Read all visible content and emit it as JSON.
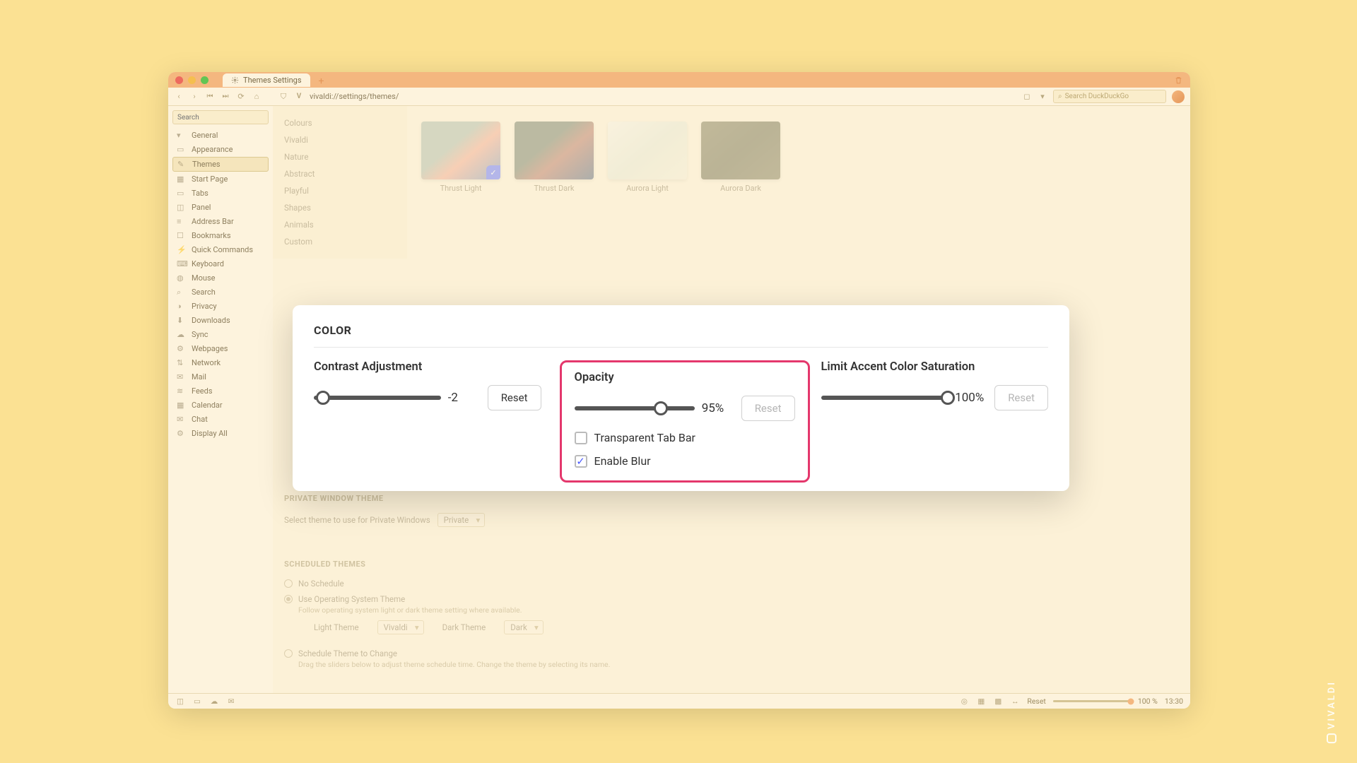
{
  "tab": {
    "title": "Themes Settings"
  },
  "address": "vivaldi://settings/themes/",
  "search_engine_placeholder": "Search DuckDuckGo",
  "sidebar": {
    "search_placeholder": "Search",
    "items": [
      {
        "label": "General",
        "icon": "chevron"
      },
      {
        "label": "Appearance",
        "icon": "folder"
      },
      {
        "label": "Themes",
        "icon": "pencil",
        "selected": true
      },
      {
        "label": "Start Page",
        "icon": "grid"
      },
      {
        "label": "Tabs",
        "icon": "tabs"
      },
      {
        "label": "Panel",
        "icon": "panel"
      },
      {
        "label": "Address Bar",
        "icon": "address"
      },
      {
        "label": "Bookmarks",
        "icon": "bookmark"
      },
      {
        "label": "Quick Commands",
        "icon": "quick"
      },
      {
        "label": "Keyboard",
        "icon": "keyboard"
      },
      {
        "label": "Mouse",
        "icon": "mouse"
      },
      {
        "label": "Search",
        "icon": "search"
      },
      {
        "label": "Privacy",
        "icon": "privacy"
      },
      {
        "label": "Downloads",
        "icon": "download"
      },
      {
        "label": "Sync",
        "icon": "sync"
      },
      {
        "label": "Webpages",
        "icon": "webpages"
      },
      {
        "label": "Network",
        "icon": "network"
      },
      {
        "label": "Mail",
        "icon": "mail"
      },
      {
        "label": "Feeds",
        "icon": "feeds"
      },
      {
        "label": "Calendar",
        "icon": "calendar"
      },
      {
        "label": "Chat",
        "icon": "chat"
      },
      {
        "label": "Display All",
        "icon": "gear"
      }
    ]
  },
  "categories": [
    "Colours",
    "Vivaldi",
    "Nature",
    "Abstract",
    "Playful",
    "Shapes",
    "Animals",
    "Custom"
  ],
  "themes": [
    {
      "name": "Thrust Light",
      "selected": true
    },
    {
      "name": "Thrust Dark"
    },
    {
      "name": "Aurora Light"
    },
    {
      "name": "Aurora Dark"
    }
  ],
  "color_panel": {
    "title": "COLOR",
    "contrast": {
      "label": "Contrast Adjustment",
      "value": "-2",
      "pct": 7,
      "reset": "Reset"
    },
    "opacity": {
      "label": "Opacity",
      "value": "95%",
      "pct": 72,
      "reset": "Reset",
      "transparent_label": "Transparent Tab Bar",
      "transparent_checked": false,
      "blur_label": "Enable Blur",
      "blur_checked": true
    },
    "saturation": {
      "label": "Limit Accent Color Saturation",
      "value": "100%",
      "pct": 100,
      "reset": "Reset"
    }
  },
  "private_theme": {
    "title": "PRIVATE WINDOW THEME",
    "label": "Select theme to use for Private Windows",
    "value": "Private"
  },
  "scheduled": {
    "title": "SCHEDULED THEMES",
    "opts": [
      {
        "label": "No Schedule",
        "selected": false,
        "desc": ""
      },
      {
        "label": "Use Operating System Theme",
        "selected": true,
        "desc": "Follow operating system light or dark theme setting where available."
      },
      {
        "label": "Schedule Theme to Change",
        "selected": false,
        "desc": "Drag the sliders below to adjust theme schedule time. Change the theme by selecting its name."
      }
    ],
    "light_label": "Light Theme",
    "light_value": "Vivaldi",
    "dark_label": "Dark Theme",
    "dark_value": "Dark"
  },
  "statusbar": {
    "reset": "Reset",
    "zoom": "100 %",
    "time": "13:30"
  },
  "brand": "VIVALDI"
}
